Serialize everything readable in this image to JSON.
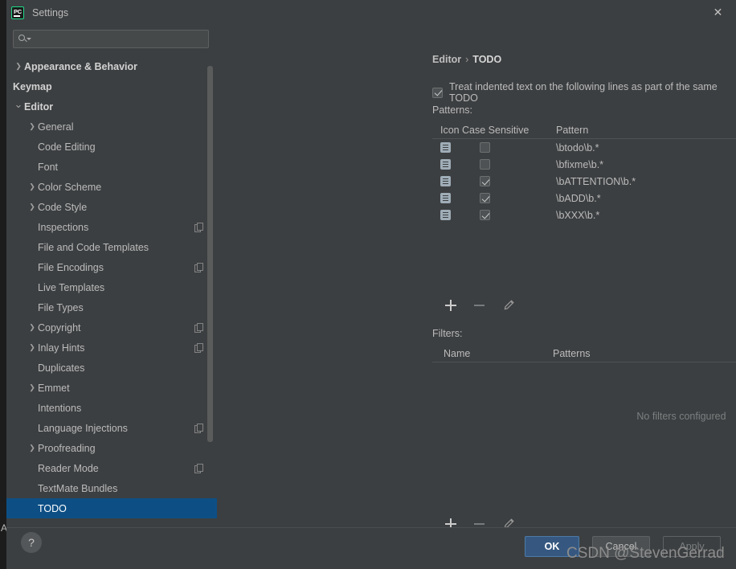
{
  "window": {
    "title": "Settings",
    "app_icon": "pycharm-icon",
    "app_icon_text": "PC",
    "close_label": "✕",
    "accent_blue": "#0d4f85",
    "ok_blue": "#365880",
    "icon_green": "#21d789"
  },
  "search": {
    "value": "",
    "placeholder": ""
  },
  "sidebar": {
    "items": [
      {
        "label": "Appearance & Behavior",
        "level": 0,
        "arrow": "closed",
        "bold": true,
        "selected": false,
        "copy": false
      },
      {
        "label": "Keymap",
        "level": 0,
        "arrow": "none",
        "bold": true,
        "selected": false,
        "copy": false
      },
      {
        "label": "Editor",
        "level": 0,
        "arrow": "open",
        "bold": true,
        "selected": false,
        "copy": false
      },
      {
        "label": "General",
        "level": 1,
        "arrow": "closed",
        "bold": false,
        "selected": false,
        "copy": false
      },
      {
        "label": "Code Editing",
        "level": 1,
        "arrow": "none",
        "bold": false,
        "selected": false,
        "copy": false
      },
      {
        "label": "Font",
        "level": 1,
        "arrow": "none",
        "bold": false,
        "selected": false,
        "copy": false
      },
      {
        "label": "Color Scheme",
        "level": 1,
        "arrow": "closed",
        "bold": false,
        "selected": false,
        "copy": false
      },
      {
        "label": "Code Style",
        "level": 1,
        "arrow": "closed",
        "bold": false,
        "selected": false,
        "copy": false
      },
      {
        "label": "Inspections",
        "level": 1,
        "arrow": "none",
        "bold": false,
        "selected": false,
        "copy": true
      },
      {
        "label": "File and Code Templates",
        "level": 1,
        "arrow": "none",
        "bold": false,
        "selected": false,
        "copy": false
      },
      {
        "label": "File Encodings",
        "level": 1,
        "arrow": "none",
        "bold": false,
        "selected": false,
        "copy": true
      },
      {
        "label": "Live Templates",
        "level": 1,
        "arrow": "none",
        "bold": false,
        "selected": false,
        "copy": false
      },
      {
        "label": "File Types",
        "level": 1,
        "arrow": "none",
        "bold": false,
        "selected": false,
        "copy": false
      },
      {
        "label": "Copyright",
        "level": 1,
        "arrow": "closed",
        "bold": false,
        "selected": false,
        "copy": true
      },
      {
        "label": "Inlay Hints",
        "level": 1,
        "arrow": "closed",
        "bold": false,
        "selected": false,
        "copy": true
      },
      {
        "label": "Duplicates",
        "level": 1,
        "arrow": "none",
        "bold": false,
        "selected": false,
        "copy": false
      },
      {
        "label": "Emmet",
        "level": 1,
        "arrow": "closed",
        "bold": false,
        "selected": false,
        "copy": false
      },
      {
        "label": "Intentions",
        "level": 1,
        "arrow": "none",
        "bold": false,
        "selected": false,
        "copy": false
      },
      {
        "label": "Language Injections",
        "level": 1,
        "arrow": "none",
        "bold": false,
        "selected": false,
        "copy": true
      },
      {
        "label": "Proofreading",
        "level": 1,
        "arrow": "closed",
        "bold": false,
        "selected": false,
        "copy": false
      },
      {
        "label": "Reader Mode",
        "level": 1,
        "arrow": "none",
        "bold": false,
        "selected": false,
        "copy": true
      },
      {
        "label": "TextMate Bundles",
        "level": 1,
        "arrow": "none",
        "bold": false,
        "selected": false,
        "copy": false
      },
      {
        "label": "TODO",
        "level": 1,
        "arrow": "none",
        "bold": false,
        "selected": true,
        "copy": false
      }
    ]
  },
  "main": {
    "breadcrumb": {
      "parent": "Editor",
      "separator": "›",
      "current": "TODO"
    },
    "treat_indented": {
      "checked": true,
      "label": "Treat indented text on the following lines as part of the same TODO"
    },
    "patterns_section": {
      "label": "Patterns:",
      "columns": [
        "Icon",
        "Case Sensitive",
        "Pattern"
      ],
      "rows": [
        {
          "icon": "todo-pattern-icon",
          "case_sensitive": false,
          "pattern": "\\btodo\\b.*"
        },
        {
          "icon": "todo-pattern-icon",
          "case_sensitive": false,
          "pattern": "\\bfixme\\b.*"
        },
        {
          "icon": "todo-pattern-icon",
          "case_sensitive": true,
          "pattern": "\\bATTENTION\\b.*"
        },
        {
          "icon": "todo-pattern-icon",
          "case_sensitive": true,
          "pattern": "\\bADD\\b.*"
        },
        {
          "icon": "todo-pattern-icon",
          "case_sensitive": true,
          "pattern": "\\bXXX\\b.*"
        }
      ],
      "toolbar": {
        "add": "+",
        "remove": "−",
        "edit": "pencil-icon"
      }
    },
    "filters_section": {
      "label": "Filters:",
      "columns": [
        "Name",
        "Patterns"
      ],
      "empty_text": "No filters configured",
      "toolbar": {
        "add": "+",
        "remove": "−",
        "edit": "pencil-icon"
      }
    }
  },
  "footer": {
    "help": "?",
    "ok": "OK",
    "cancel": "Cancel",
    "apply": "Apply"
  },
  "watermark": "CSDN @StevenGerrad",
  "background": {
    "edge_letter": "A"
  }
}
